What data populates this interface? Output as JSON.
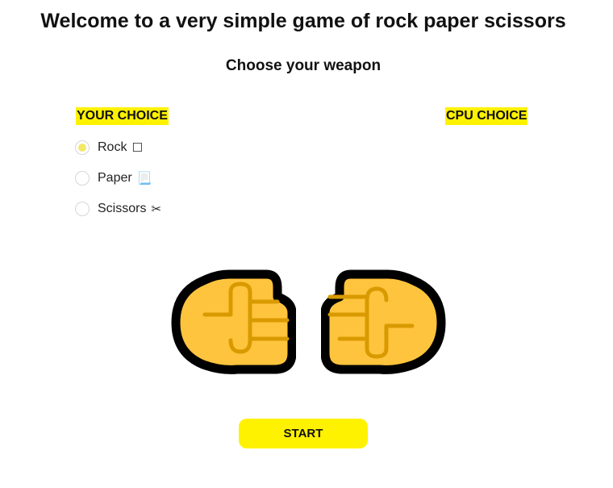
{
  "header": {
    "title": "Welcome to a very simple game of rock paper scissors",
    "subtitle": "Choose your weapon"
  },
  "labels": {
    "your_choice": "YOUR CHOICE",
    "cpu_choice": "CPU CHOICE"
  },
  "options": [
    {
      "label": "Rock",
      "icon": "☐",
      "icon_name": "rock-box-icon",
      "selected": true
    },
    {
      "label": "Paper",
      "icon": "📃",
      "icon_name": "paper-scroll-icon",
      "selected": false
    },
    {
      "label": "Scissors",
      "icon": "✂",
      "icon_name": "scissors-icon",
      "selected": false
    }
  ],
  "hands": {
    "player": "fist-left",
    "cpu": "fist-right"
  },
  "button": {
    "start_label": "START"
  },
  "colors": {
    "accent": "#fff200",
    "radio_selected": "#f3e868",
    "fist_fill": "#ffc43d",
    "fist_line": "#d99a00",
    "fist_outline": "#000000"
  }
}
